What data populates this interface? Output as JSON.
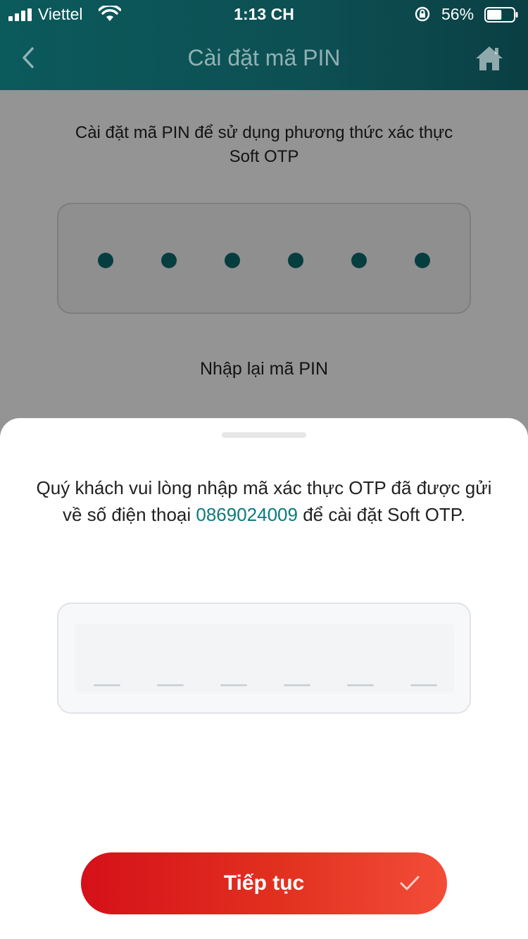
{
  "status_bar": {
    "carrier": "Viettel",
    "time": "1:13 CH",
    "battery_percent": "56%",
    "battery_level": 0.56,
    "icons": [
      "signal-icon",
      "wifi-icon",
      "orientation-lock-icon",
      "battery-icon"
    ]
  },
  "header": {
    "title": "Cài đặt mã PIN",
    "back_icon": "chevron-left-icon",
    "home_icon": "home-icon"
  },
  "pin_setup": {
    "description": "Cài đặt mã PIN để sử dụng phương thức xác thực Soft OTP",
    "pin_length": 6,
    "filled_digits": 6,
    "repeat_label": "Nhập lại mã PIN"
  },
  "otp_sheet": {
    "message_before": "Quý khách vui lòng nhập mã xác thực OTP đã được gửi về số điện thoại ",
    "phone_number": "0869024009",
    "message_after": " để cài đặt Soft OTP.",
    "otp_length": 6
  },
  "continue_button": {
    "label": "Tiếp tục",
    "icon": "check-icon"
  },
  "colors": {
    "header": "#0b5a5c",
    "accent_teal": "#0c7a7d",
    "button_red": "#d5101a"
  }
}
